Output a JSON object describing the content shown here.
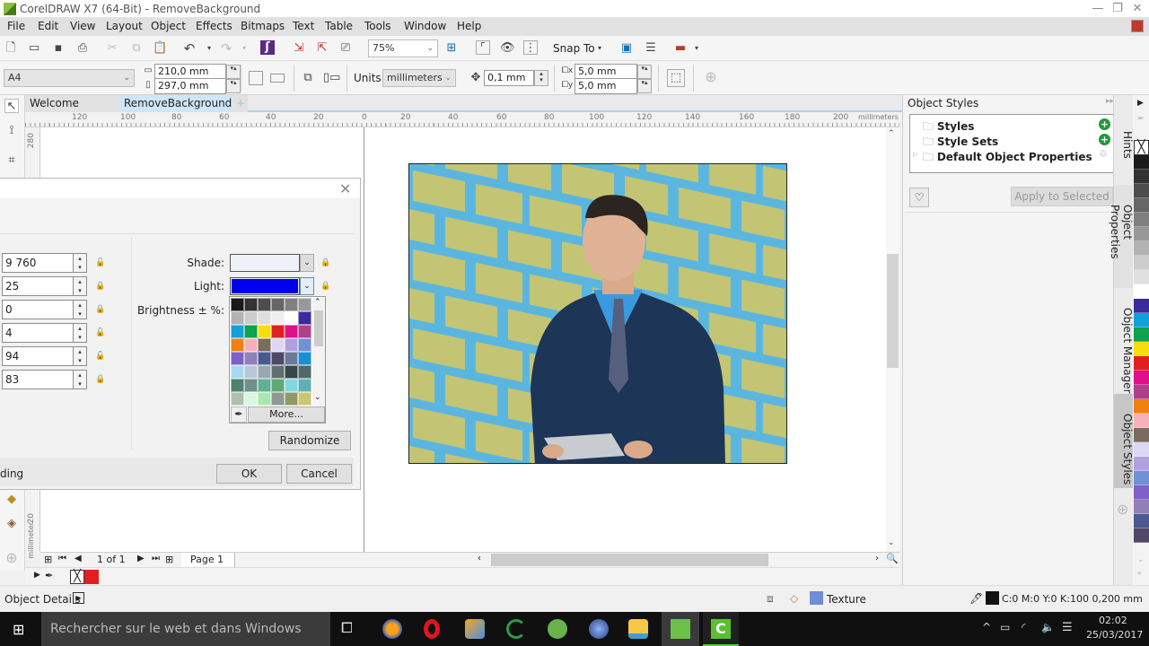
{
  "window": {
    "title": "CorelDRAW X7 (64-Bit) - RemoveBackground",
    "controls": {
      "minimize": "—",
      "restore": "❐",
      "close": "✕"
    }
  },
  "menu": [
    "File",
    "Edit",
    "View",
    "Layout",
    "Object",
    "Effects",
    "Bitmaps",
    "Text",
    "Table",
    "Tools",
    "Window",
    "Help"
  ],
  "toolbar": {
    "zoom_level": "75%",
    "snap_to": "Snap To",
    "icons": [
      "new-document-icon",
      "open-icon",
      "save-icon",
      "print-icon",
      "cut-icon",
      "copy-icon",
      "paste-icon",
      "undo-icon",
      "redo-icon",
      "corel-connect-icon",
      "import-icon",
      "export-icon",
      "publish-pdf-icon",
      "full-screen-preview-icon",
      "rulers-icon",
      "grid-icon",
      "guidelines-icon",
      "options-icon",
      "app-launcher-icon",
      "welcome-screen-icon"
    ]
  },
  "property_bar": {
    "page_size": "A4",
    "width": "210,0 mm",
    "height": "297,0 mm",
    "units_label": "Units:",
    "units_value": "millimeters",
    "nudge": "0,1 mm",
    "dup_x": "5,0 mm",
    "dup_y": "5,0 mm"
  },
  "doc_tabs": [
    "Welcome Screen",
    "RemoveBackground"
  ],
  "ruler": {
    "h_labels": [
      "120",
      "100",
      "80",
      "60",
      "40",
      "20",
      "0",
      "20",
      "40",
      "60",
      "80",
      "100",
      "120",
      "140",
      "160",
      "180",
      "200"
    ],
    "unit": "millimeters",
    "v_labels": [
      "280",
      "20"
    ],
    "v_unit": "millimeter"
  },
  "dialog": {
    "fields": [
      {
        "value": "9 760",
        "locked": false
      },
      {
        "value": "25",
        "locked": true
      },
      {
        "value": "0",
        "locked": true
      },
      {
        "value": "4",
        "locked": false
      },
      {
        "value": "94",
        "locked": false
      },
      {
        "value": "83",
        "locked": true
      }
    ],
    "shade_label": "Shade:",
    "shade_color": "#eef0fb",
    "light_label": "Light:",
    "light_color": "#0000f0",
    "brightness_label": "Brightness ± %:",
    "more_label": "More...",
    "randomize_label": "Randomize",
    "footer_text": "ding",
    "ok_label": "OK",
    "cancel_label": "Cancel",
    "palette": [
      "#1a1a1a",
      "#333333",
      "#4d4d4d",
      "#666666",
      "#808080",
      "#999999",
      "#b3b3b3",
      "#cccccc",
      "#dedede",
      "#efefef",
      "#ffffff",
      "#3a2aa0",
      "#13a0d8",
      "#10a050",
      "#f7dd10",
      "#e02020",
      "#e0108c",
      "#b0408c",
      "#f08010",
      "#f8b0b8",
      "#7a6a60",
      "#dcd8f4",
      "#b0a0e0",
      "#7090d8",
      "#8060c8",
      "#9080b8",
      "#4a5a90",
      "#504868",
      "#6a7a98",
      "#1a90d0",
      "#a8d8f0",
      "#b8c8d8",
      "#98a8b0",
      "#607070",
      "#384848",
      "#506868",
      "#508070",
      "#709088",
      "#60b098",
      "#60a878",
      "#80d8e0",
      "#60b0b8",
      "#b0c0b0",
      "#d8f8e0",
      "#a8e8b0",
      "#909890",
      "#909868",
      "#c8c870"
    ]
  },
  "page_nav": {
    "counter": "1 of 1",
    "page_tab": "Page 1"
  },
  "docker": {
    "title": "Object Styles",
    "tree": [
      {
        "label": "Styles",
        "action": "add"
      },
      {
        "label": "Style Sets",
        "action": "add"
      },
      {
        "label": "Default Object Properties",
        "action": "reset"
      }
    ],
    "apply_label": "Apply to Selected",
    "tabs": [
      "Hints",
      "Object Properties",
      "Object Manager",
      "Object Styles"
    ]
  },
  "right_palette": [
    "#1a1a1a",
    "#333333",
    "#4d4d4d",
    "#666666",
    "#808080",
    "#999999",
    "#b3b3b3",
    "#cccccc",
    "#e0e0e0",
    "#ffffff",
    "#3a2aa0",
    "#13a0d8",
    "#10a050",
    "#f7dd10",
    "#e02020",
    "#e0108c",
    "#b0408c",
    "#f08010",
    "#f8b0b8",
    "#7a6a60",
    "#dcd8f4",
    "#b0a0e0",
    "#7090d8",
    "#8060c8",
    "#9080b8",
    "#4a5a90",
    "#504868"
  ],
  "status": {
    "object_details": "Object Details",
    "fill_type": "Texture",
    "outline": "C:0 M:0 Y:0 K:100  0,200 mm"
  },
  "document_colors": [
    "#e02020"
  ],
  "taskbar": {
    "search_placeholder": "Rechercher sur le web et dans Windows",
    "time": "02:02",
    "date": "25/03/2017",
    "apps": [
      "task-view",
      "firefox",
      "opera",
      "app-orange",
      "app-green-swirl",
      "app-share",
      "browser-globe",
      "file-explorer",
      "coreldraw",
      "camtasia"
    ]
  },
  "photo": {
    "background_color": "#5bb6df",
    "brick_color": "#c3c574",
    "subject": "businessman-with-tablet"
  }
}
